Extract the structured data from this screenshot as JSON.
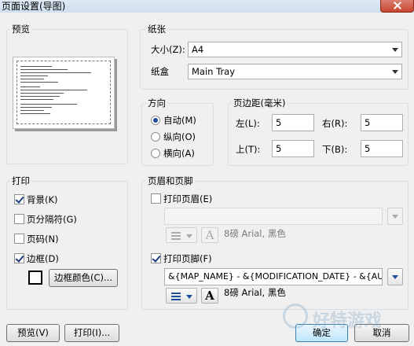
{
  "window": {
    "title": "页面设置(导图)"
  },
  "preview": {
    "label": "预览"
  },
  "paper": {
    "label": "纸张",
    "size_label": "大小(Z):",
    "size_value": "A4",
    "tray_label": "纸盒",
    "tray_value": "Main Tray"
  },
  "orientation": {
    "label": "方向",
    "options": [
      {
        "label": "自动(M)",
        "selected": true
      },
      {
        "label": "纵向(O)",
        "selected": false
      },
      {
        "label": "横向(A)",
        "selected": false
      }
    ]
  },
  "margins": {
    "label": "页边距(毫米)",
    "left_label": "左(L):",
    "left_value": "5",
    "right_label": "右(R):",
    "right_value": "5",
    "top_label": "上(T):",
    "top_value": "5",
    "bottom_label": "下(B):",
    "bottom_value": "5"
  },
  "print": {
    "label": "打印",
    "background": {
      "label": "背景(K)",
      "checked": true
    },
    "page_break": {
      "label": "页分隔符(G)",
      "checked": false
    },
    "page_number": {
      "label": "页码(N)",
      "checked": false
    },
    "border": {
      "label": "边框(D)",
      "checked": true
    },
    "border_color_button": "边框颜色(C)..."
  },
  "header_footer": {
    "label": "页眉和页脚",
    "print_header": {
      "label": "打印页眉(E)",
      "checked": false
    },
    "header_value": "",
    "header_font": "8磅 Arial, 黑色",
    "print_footer": {
      "label": "打印页脚(F)",
      "checked": true
    },
    "footer_value": "&{MAP_NAME} - &{MODIFICATION_DATE} - &{AUTHOR",
    "footer_font": "8磅 Arial, 黑色"
  },
  "buttons": {
    "preview": "预览(V)",
    "print": "打印(I)...",
    "ok": "确定",
    "cancel": "取消"
  },
  "watermark": {
    "text": "好特游戏"
  },
  "colors": {
    "accent": "#1e4f9a",
    "group_border": "#d5dfe5",
    "default_button": "#3c7fb1"
  }
}
